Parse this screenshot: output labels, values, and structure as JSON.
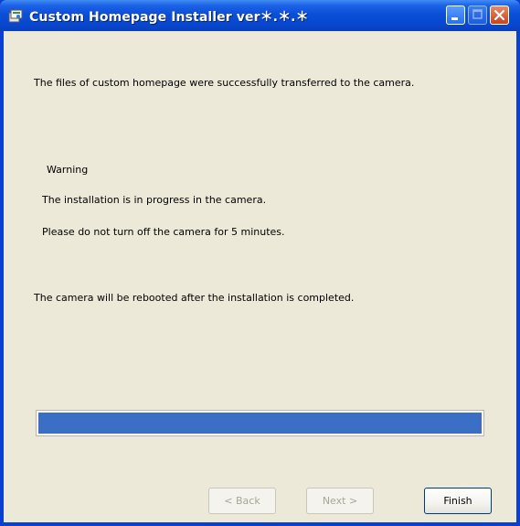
{
  "window": {
    "title": "Custom Homepage Installer ver＊.＊.＊"
  },
  "messages": {
    "transfer_success": "The files of custom homepage were successfully transferred to the camera.",
    "warning_heading": "Warning",
    "installation_in_progress": "The installation is in progress in the camera.",
    "do_not_turn_off": "Please do not turn off the camera for 5 minutes.",
    "reboot_notice": "The camera will be rebooted after the installation is completed."
  },
  "progress": {
    "fraction": 1.0,
    "fill_color": "#3a6fc5"
  },
  "buttons": {
    "back_label": "< Back",
    "next_label": "Next >",
    "finish_label": "Finish"
  },
  "colors": {
    "titlebar": "#0a4fd8",
    "dialog_background": "#ece9d8",
    "close_button": "#c7441b"
  },
  "icons": {
    "app": "installer-app-icon",
    "minimize": "minimize-icon",
    "maximize": "maximize-icon",
    "close": "close-icon"
  }
}
